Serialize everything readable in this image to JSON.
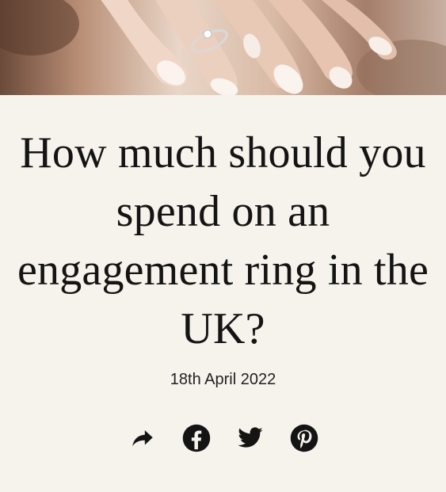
{
  "hero": {
    "image_subject": "hand-with-engagement-ring"
  },
  "article": {
    "title": "How much should you spend on an engagement ring in the UK?",
    "date": "18th April 2022"
  },
  "share": {
    "items": [
      {
        "icon": "share-arrow-icon"
      },
      {
        "icon": "facebook-icon"
      },
      {
        "icon": "twitter-icon"
      },
      {
        "icon": "pinterest-icon"
      }
    ]
  },
  "colors": {
    "background": "#f6f2ec",
    "text": "#141414"
  }
}
